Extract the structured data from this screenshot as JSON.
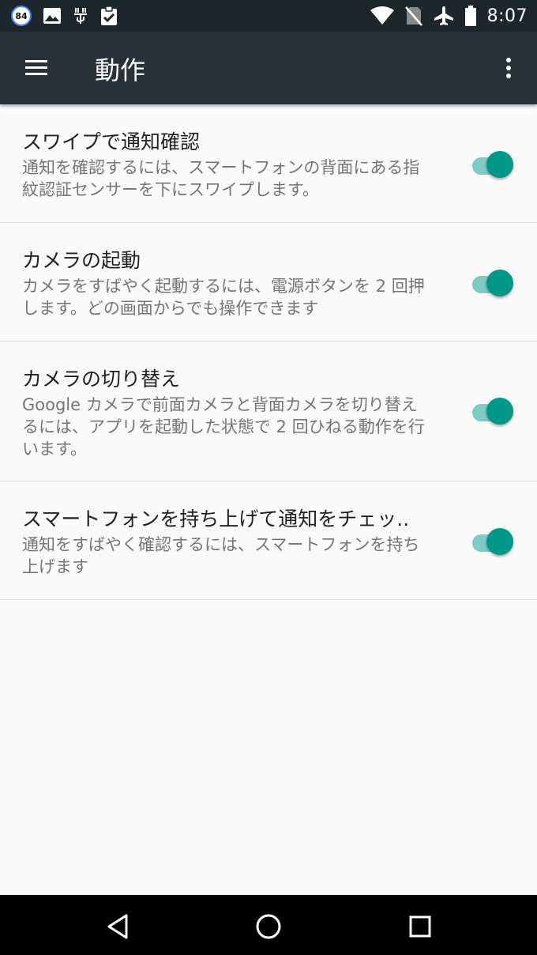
{
  "status_bar": {
    "notification_count": "84",
    "time": "8:07",
    "icons": [
      "image-icon",
      "usb-debug-icon",
      "clipboard-check-icon",
      "wifi-icon",
      "no-sim-icon",
      "airplane-icon",
      "battery-icon"
    ]
  },
  "app_bar": {
    "title": "動作"
  },
  "settings": [
    {
      "title": "スワイプで通知確認",
      "subtitle": "通知を確認するには、スマートフォンの背面にある指紋認証センサーを下にスワイプします。",
      "enabled": true
    },
    {
      "title": "カメラの起動",
      "subtitle": "カメラをすばやく起動するには、電源ボタンを 2 回押します。どの画面からでも操作できます",
      "enabled": true
    },
    {
      "title": "カメラの切り替え",
      "subtitle": "Google カメラで前面カメラと背面カメラを切り替えるには、アプリを起動した状態で 2 回ひねる動作を行います。",
      "enabled": true
    },
    {
      "title": "スマートフォンを持ち上げて通知をチェッ..",
      "subtitle": "通知をすばやく確認するには、スマートフォンを持ち上げます",
      "enabled": true
    }
  ],
  "colors": {
    "app_bar": "#263238",
    "status_bar": "#1d262b",
    "accent": "#009688",
    "accent_track": "#80cbc4"
  }
}
